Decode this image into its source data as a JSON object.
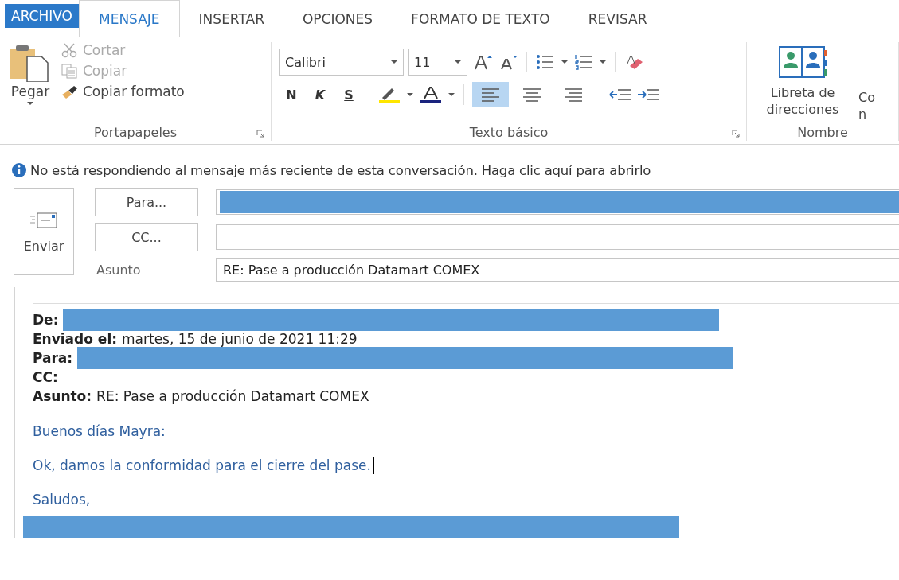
{
  "tabs": [
    {
      "label": "ARCHIVO",
      "kind": "file",
      "selected": false
    },
    {
      "label": "MENSAJE",
      "kind": "tab",
      "selected": true
    },
    {
      "label": "INSERTAR",
      "kind": "tab",
      "selected": false
    },
    {
      "label": "OPCIONES",
      "kind": "tab",
      "selected": false
    },
    {
      "label": "FORMATO DE TEXTO",
      "kind": "tab",
      "selected": false
    },
    {
      "label": "REVISAR",
      "kind": "tab",
      "selected": false
    }
  ],
  "clipboard": {
    "paste": "Pegar",
    "items": [
      {
        "label": "Cortar",
        "kind": "cut",
        "disabled": true
      },
      {
        "label": "Copiar",
        "kind": "copy",
        "disabled": true
      },
      {
        "label": "Copiar formato",
        "kind": "brush",
        "disabled": false
      }
    ],
    "group": "Portapapeles"
  },
  "basic_text": {
    "font": "Calibri",
    "size": "11",
    "styles": [
      "N",
      "K",
      "S"
    ],
    "alignment": [
      {
        "selected": true
      },
      {
        "selected": false
      },
      {
        "selected": false
      }
    ],
    "group": "Texto básico"
  },
  "names": {
    "address_book": "Libreta de direcciones",
    "cut_button": "Co n",
    "group": "Nombre"
  },
  "info_bar": "No está respondiendo al mensaje más reciente de esta conversación. Haga clic aquí para abrirlo",
  "send": "Enviar",
  "fields": [
    {
      "label": "Para...",
      "kind": "button",
      "redacted": true
    },
    {
      "label": "CC...",
      "kind": "button"
    },
    {
      "label": "Asunto",
      "kind": "label",
      "value": "RE: Pase a producción Datamart COMEX"
    }
  ],
  "header": [
    {
      "label": "De:",
      "redacted": true
    },
    {
      "label": "Enviado el:",
      "value": "martes, 15 de junio de 2021 11:29"
    },
    {
      "label": "Para:",
      "redacted": true
    },
    {
      "label": "CC:"
    },
    {
      "label": "Asunto:",
      "value": "RE: Pase a producción Datamart COMEX"
    }
  ],
  "body": [
    "Buenos días Mayra:",
    "Ok, damos la conformidad para el cierre del pase.",
    "Saludos,"
  ],
  "signature_redacted": true
}
